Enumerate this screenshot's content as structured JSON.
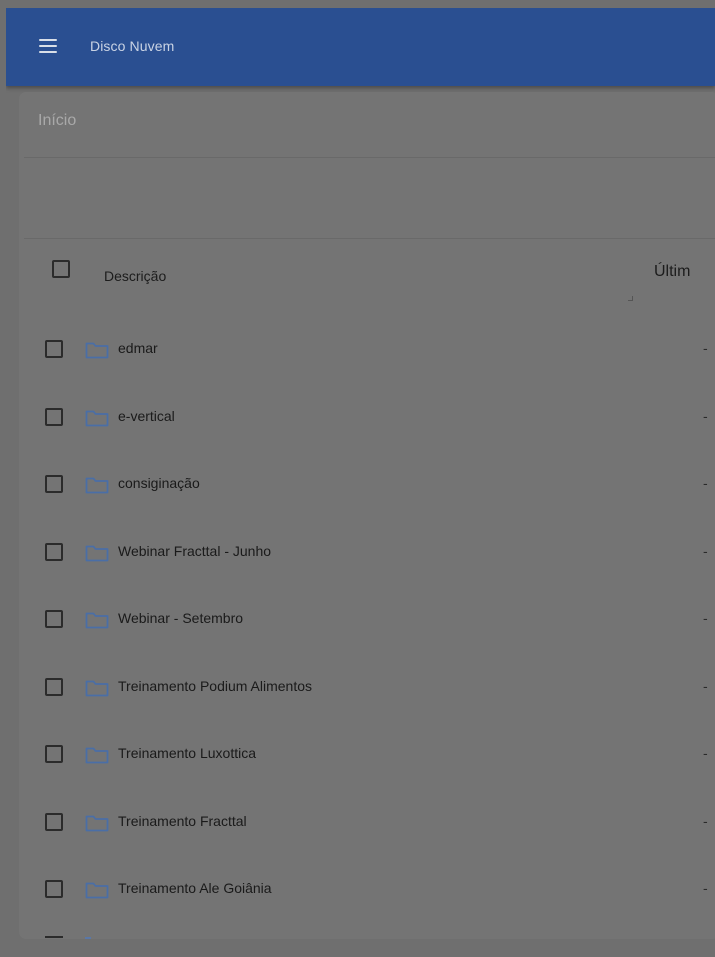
{
  "app_bar": {
    "menu_icon": "hamburger-menu-icon",
    "title": "Disco Nuvem",
    "color": "#2a4f91"
  },
  "breadcrumb": {
    "current": "Início"
  },
  "table": {
    "columns": [
      "Descrição",
      "Últim"
    ],
    "folder_color": "#4a6ea6",
    "rows": [
      {
        "name": "edmar",
        "modified": "-"
      },
      {
        "name": "e-vertical",
        "modified": "-"
      },
      {
        "name": "consiginação",
        "modified": "-"
      },
      {
        "name": "Webinar Fracttal - Junho",
        "modified": "-"
      },
      {
        "name": "Webinar - Setembro",
        "modified": "-"
      },
      {
        "name": "Treinamento Podium Alimentos",
        "modified": "-"
      },
      {
        "name": "Treinamento Luxottica",
        "modified": "-"
      },
      {
        "name": "Treinamento Fracttal",
        "modified": "-"
      },
      {
        "name": "Treinamento Ale Goiânia",
        "modified": "-"
      }
    ]
  }
}
